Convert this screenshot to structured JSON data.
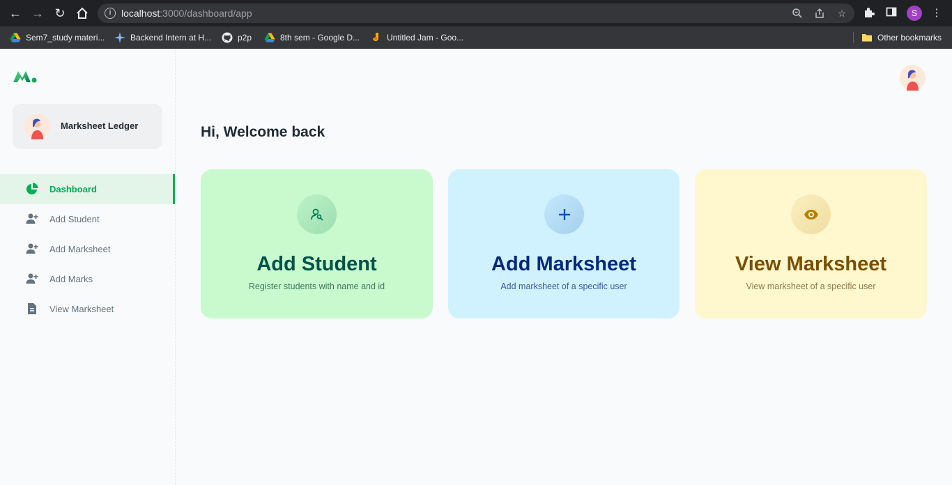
{
  "browser": {
    "url_host": "localhost",
    "url_path": ":3000/dashboard/app",
    "profile_initial": "S",
    "bookmarks": [
      {
        "label": "Sem7_study materi...",
        "icon": "google-drive-icon"
      },
      {
        "label": "Backend Intern at H...",
        "icon": "sparkle-icon"
      },
      {
        "label": "p2p",
        "icon": "github-icon"
      },
      {
        "label": "8th sem - Google D...",
        "icon": "google-drive-icon"
      },
      {
        "label": "Untitled Jam - Goo...",
        "icon": "jamboard-icon"
      }
    ],
    "other_bookmarks": "Other bookmarks"
  },
  "sidebar": {
    "account_name": "Marksheet Ledger",
    "items": [
      {
        "label": "Dashboard",
        "icon": "pie-chart-icon",
        "active": true
      },
      {
        "label": "Add Student",
        "icon": "person-add-icon"
      },
      {
        "label": "Add Marksheet",
        "icon": "person-add-icon"
      },
      {
        "label": "Add Marks",
        "icon": "person-add-icon"
      },
      {
        "label": "View Marksheet",
        "icon": "file-text-icon"
      }
    ]
  },
  "main": {
    "greeting": "Hi, Welcome back",
    "cards": [
      {
        "title": "Add Student",
        "subtitle": "Register students with name and id",
        "icon": "people-search-icon",
        "color": "#c8facd"
      },
      {
        "title": "Add Marksheet",
        "subtitle": "Add marksheet of a specific user",
        "icon": "plus-icon",
        "color": "#d0f2ff"
      },
      {
        "title": "View Marksheet",
        "subtitle": "View marksheet of a specific user",
        "icon": "eye-icon",
        "color": "#fff7cd"
      }
    ]
  },
  "colors": {
    "primary": "#00ab55",
    "browser_bg": "#202124"
  }
}
